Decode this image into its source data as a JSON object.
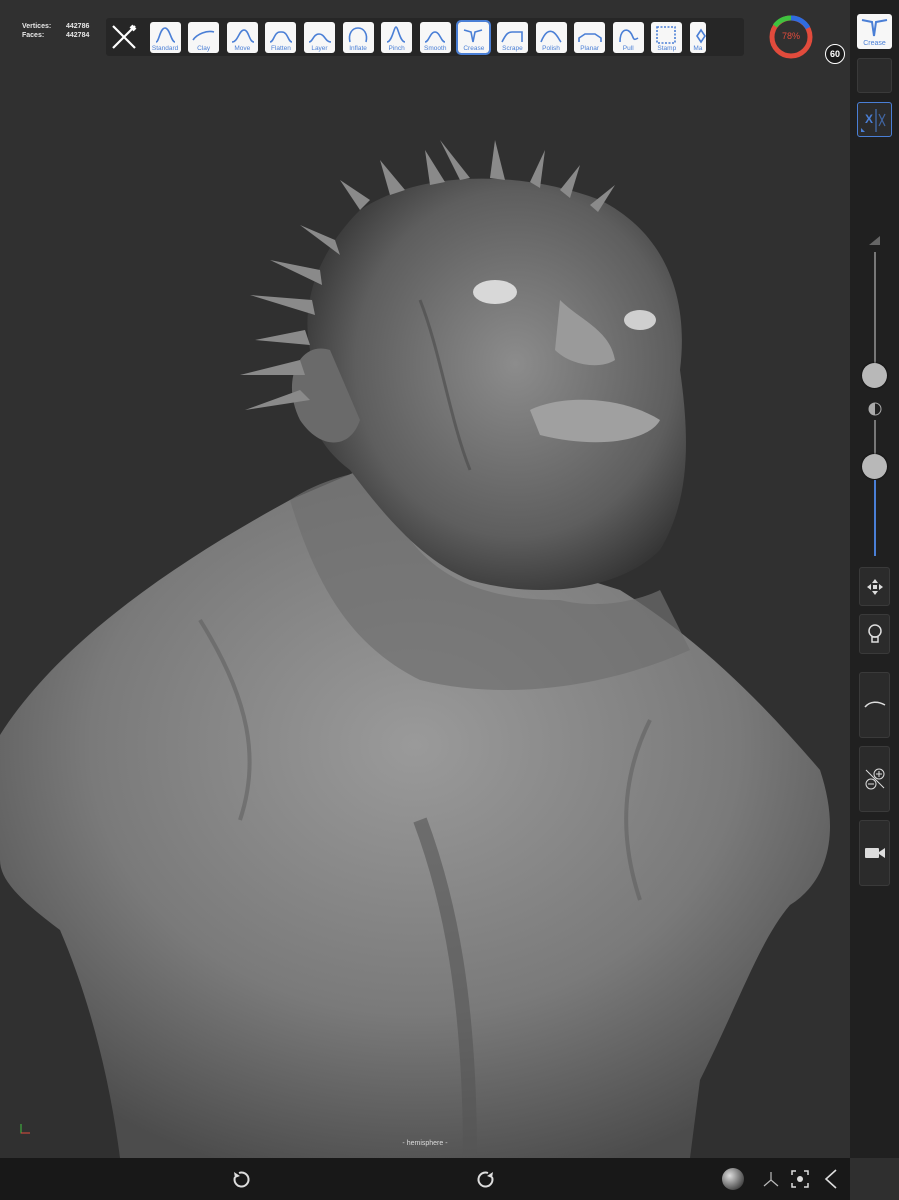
{
  "stats": {
    "vertices_label": "Vertices:",
    "vertices_value": "442786",
    "faces_label": "Faces:",
    "faces_value": "442784"
  },
  "toolbar": {
    "brushes": [
      {
        "label": "Standard"
      },
      {
        "label": "Clay"
      },
      {
        "label": "Move"
      },
      {
        "label": "Flatten"
      },
      {
        "label": "Layer"
      },
      {
        "label": "Inflate"
      },
      {
        "label": "Pinch"
      },
      {
        "label": "Smooth"
      },
      {
        "label": "Crease",
        "selected": true
      },
      {
        "label": "Scrape"
      },
      {
        "label": "Polish"
      },
      {
        "label": "Planar"
      },
      {
        "label": "Pull"
      },
      {
        "label": "Stamp"
      },
      {
        "label": "Ma"
      }
    ]
  },
  "memory": {
    "percent_label": "78%",
    "percent": 78
  },
  "fps": "60",
  "sidebar": {
    "active_brush_label": "Crease",
    "symmetry_label": "X"
  },
  "viewport": {
    "mirror_label": "- hemisphere -"
  },
  "colors": {
    "accent": "#4a7fd6",
    "ring_red": "#e14b3c",
    "ring_green": "#3fc23f",
    "ring_blue": "#2f6ce0"
  }
}
